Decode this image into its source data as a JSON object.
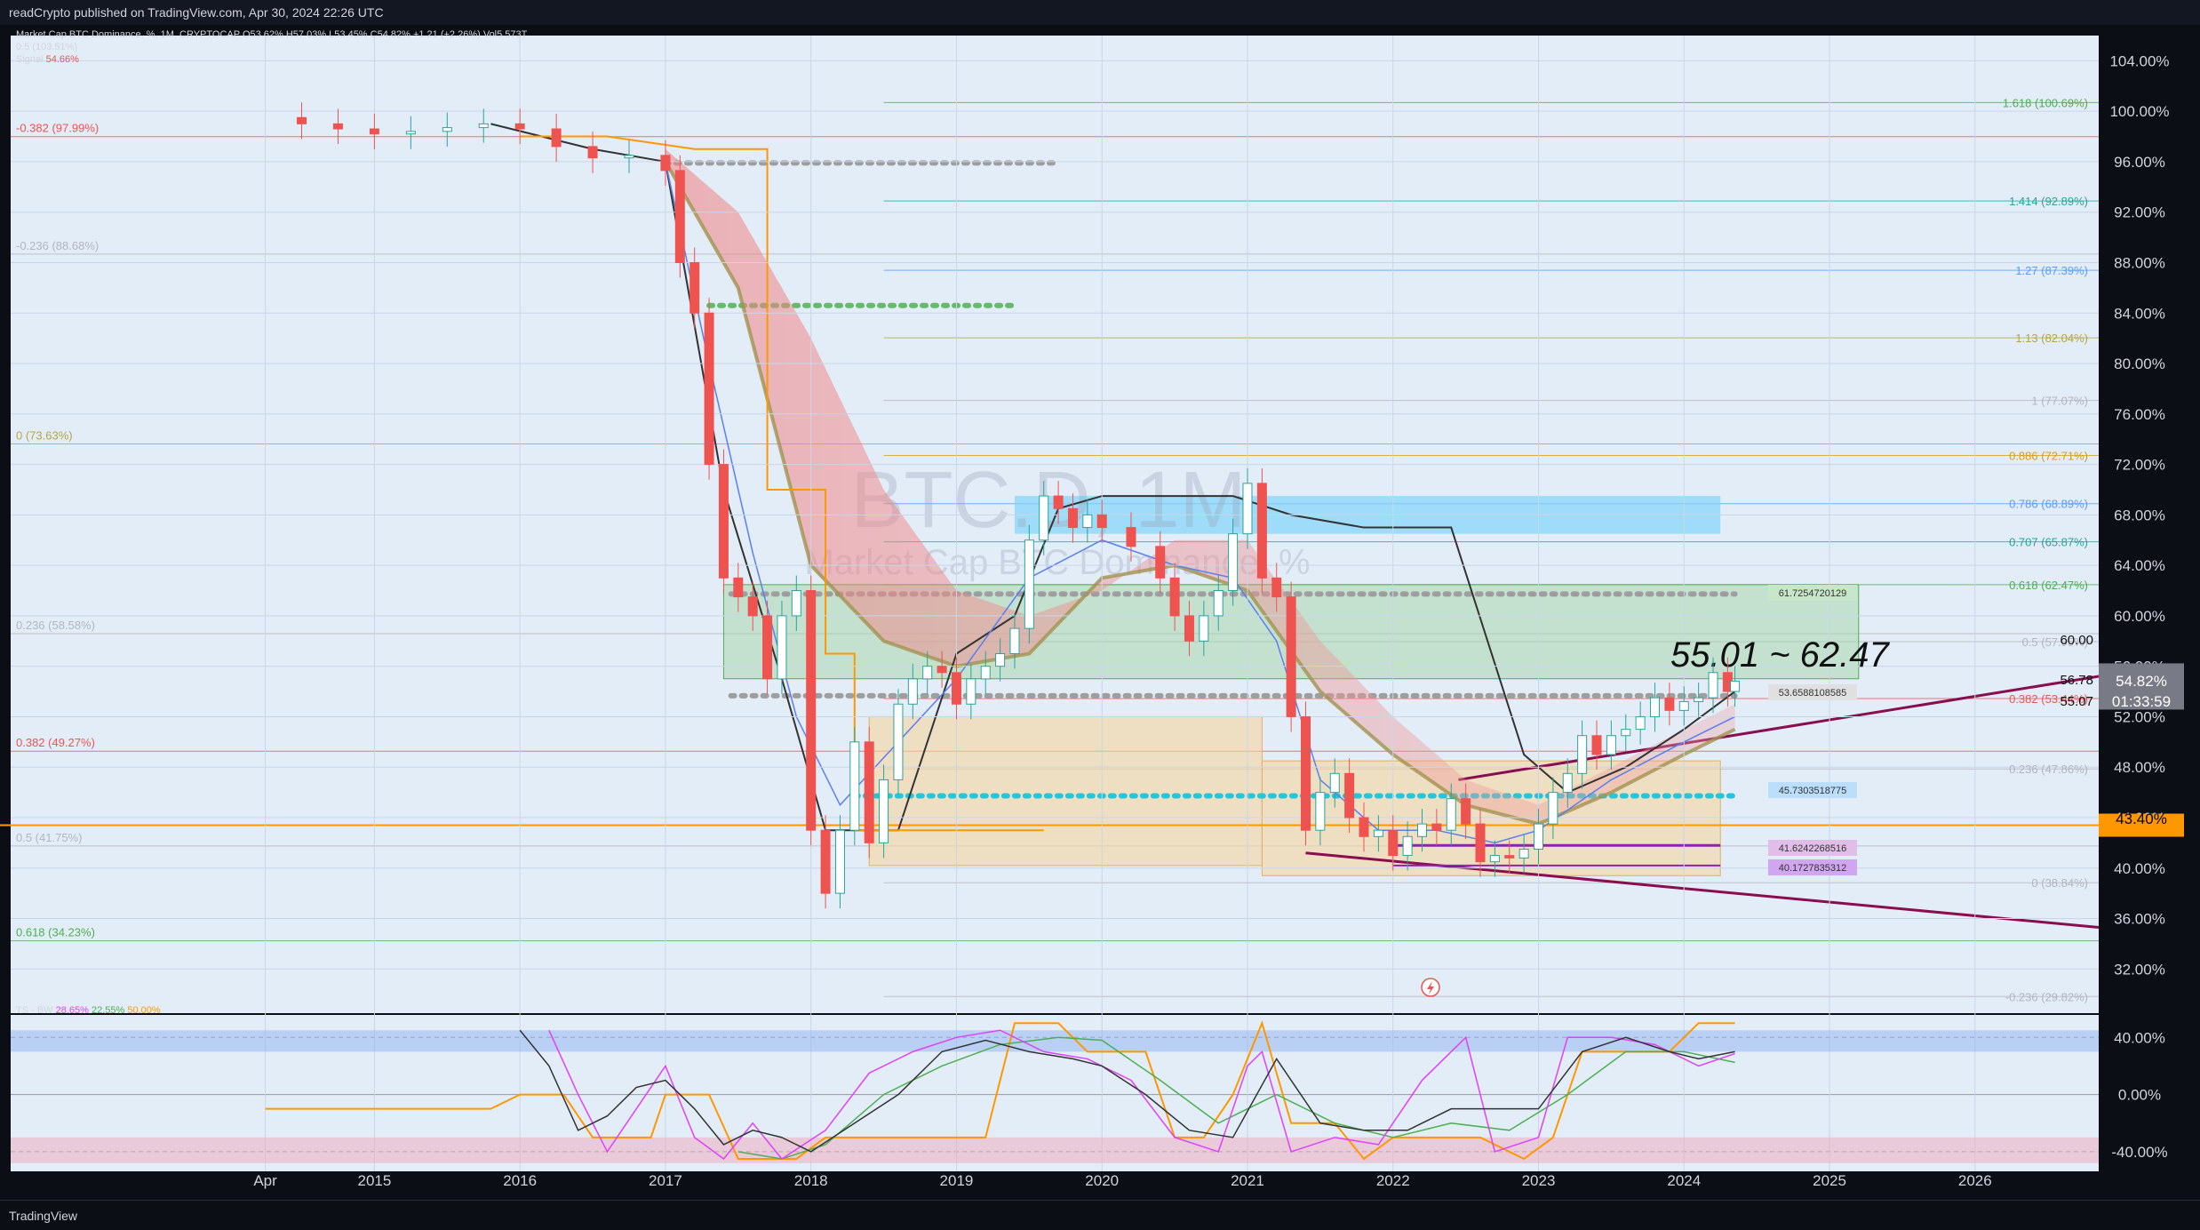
{
  "header": {
    "published": "readCrypto published on TradingView.com, Apr 30, 2024 22:26 UTC"
  },
  "legend": {
    "symbol_line": "Market Cap BTC Dominance, %, 1M, CRYPTOCAP",
    "ohlc": "O53.62% H57.03% L53.45% C54.82% +1.21 (+2.26%) Vol5.573T",
    "indicator_line": "0.5 (103.51%)",
    "signal_label": "Signal",
    "signal_value": "54.66%",
    "oscillator_label": "TS - BW",
    "osc_values": [
      "28.65%",
      "22.55%",
      "50.00%"
    ]
  },
  "watermark": {
    "symbol": "BTC.D, 1M",
    "description": "Market Cap BTC Dominance, %"
  },
  "annotation": {
    "range_text": "55.01 ~ 62.47"
  },
  "right_axis": {
    "price_label": "54.82%",
    "countdown": "01:33:59",
    "level_label": "43.40%",
    "level_color": "#ff9800",
    "price_color": "#787b86"
  },
  "badge_labels": {
    "b1": "61.7254720129",
    "b2": "53.6588108585",
    "b3": "45.7303518775",
    "b4": "41.6242268516",
    "b5": "40.1727835312",
    "b6": "60.00",
    "b7": "56.78",
    "b8": "55.07"
  },
  "left_fib_labels": [
    {
      "text": "-0.382 (97.99%)",
      "value": 97.99,
      "color": "#ef5350"
    },
    {
      "text": "-0.236 (88.68%)",
      "value": 88.68,
      "color": "#b2b5be"
    },
    {
      "text": "0 (73.63%)",
      "value": 73.63,
      "color": "#b5a642"
    },
    {
      "text": "0.236 (58.58%)",
      "value": 58.58,
      "color": "#b2b5be"
    },
    {
      "text": "0.382 (49.27%)",
      "value": 49.27,
      "color": "#ef5350"
    },
    {
      "text": "0.5 (41.75%)",
      "value": 41.75,
      "color": "#b2b5be"
    },
    {
      "text": "0.618 (34.23%)",
      "value": 34.23,
      "color": "#4caf50"
    }
  ],
  "right_fib_labels": [
    {
      "text": "1.618 (100.69%)",
      "value": 100.69,
      "color": "#4caf50"
    },
    {
      "text": "1.414 (92.89%)",
      "value": 92.89,
      "color": "#26a69a"
    },
    {
      "text": "1.27 (87.39%)",
      "value": 87.39,
      "color": "#5b9cf6"
    },
    {
      "text": "1.13 (82.04%)",
      "value": 82.04,
      "color": "#b5a642"
    },
    {
      "text": "1 (77.07%)",
      "value": 77.07,
      "color": "#b2b5be"
    },
    {
      "text": "0.886 (72.71%)",
      "value": 72.71,
      "color": "#d4a017"
    },
    {
      "text": "0.786 (68.89%)",
      "value": 68.89,
      "color": "#5b9cf6"
    },
    {
      "text": "0.707 (65.87%)",
      "value": 65.87,
      "color": "#26a69a"
    },
    {
      "text": "0.618 (62.47%)",
      "value": 62.47,
      "color": "#4caf50"
    },
    {
      "text": "0.5 (57.95%)",
      "value": 57.95,
      "color": "#b2b5be"
    },
    {
      "text": "0.382 (53.44%)",
      "value": 53.44,
      "color": "#ef5350"
    },
    {
      "text": "0.236 (47.86%)",
      "value": 47.86,
      "color": "#b2b5be"
    },
    {
      "text": "0 (38.84%)",
      "value": 38.84,
      "color": "#b2b5be"
    },
    {
      "text": "-0.236 (29.82%)",
      "value": 29.82,
      "color": "#b2b5be"
    }
  ],
  "chart_data": {
    "type": "line",
    "title": "",
    "ylabel": "",
    "ylim": [
      28.5,
      106
    ],
    "price_ticks": [
      "104.00%",
      "100.00%",
      "96.00%",
      "92.00%",
      "88.00%",
      "84.00%",
      "80.00%",
      "76.00%",
      "72.00%",
      "68.00%",
      "64.00%",
      "60.00%",
      "56.00%",
      "52.00%",
      "48.00%",
      "44.00%",
      "40.00%",
      "36.00%",
      "32.00%"
    ],
    "price_tick_values": [
      104,
      100,
      96,
      92,
      88,
      84,
      80,
      76,
      72,
      68,
      64,
      60,
      56,
      52,
      48,
      44,
      40,
      36,
      32
    ],
    "x_tick_labels": [
      "Apr",
      "2015",
      "2016",
      "2017",
      "2018",
      "2019",
      "2020",
      "2021",
      "2022",
      "2023",
      "2024",
      "2025",
      "2026"
    ],
    "x_tick_years": [
      2014.25,
      2015,
      2016,
      2017,
      2018,
      2019,
      2020,
      2021,
      2022,
      2023,
      2024,
      2025,
      2026
    ],
    "xlim": [
      2012.5,
      2026.85
    ],
    "series": [
      {
        "values": [
          [
            2014.25,
            99.5
          ],
          [
            2014.5,
            99.0
          ],
          [
            2014.75,
            98.6
          ],
          [
            2015.0,
            98.2
          ],
          [
            2015.25,
            98.4
          ],
          [
            2015.5,
            98.7
          ],
          [
            2015.75,
            99.0
          ],
          [
            2016.0,
            98.6
          ],
          [
            2016.25,
            97.2
          ],
          [
            2016.5,
            96.3
          ],
          [
            2016.75,
            96.5
          ],
          [
            2017.0,
            95.3
          ],
          [
            2017.1,
            88.0
          ],
          [
            2017.2,
            84.0
          ],
          [
            2017.3,
            72.0
          ],
          [
            2017.4,
            63.0
          ],
          [
            2017.5,
            61.5
          ],
          [
            2017.6,
            60.0
          ],
          [
            2017.7,
            55.0
          ],
          [
            2017.8,
            60.0
          ],
          [
            2017.9,
            62.0
          ],
          [
            2018.0,
            43.0
          ],
          [
            2018.1,
            38.0
          ],
          [
            2018.2,
            43.0
          ],
          [
            2018.3,
            50.0
          ],
          [
            2018.4,
            42.0
          ],
          [
            2018.5,
            47.0
          ],
          [
            2018.6,
            53.0
          ],
          [
            2018.7,
            55.0
          ],
          [
            2018.8,
            56.0
          ],
          [
            2018.9,
            55.5
          ],
          [
            2019.0,
            53.0
          ],
          [
            2019.1,
            55.0
          ],
          [
            2019.2,
            56.0
          ],
          [
            2019.3,
            57.0
          ],
          [
            2019.4,
            59.0
          ],
          [
            2019.5,
            66.0
          ],
          [
            2019.6,
            69.5
          ],
          [
            2019.7,
            68.5
          ],
          [
            2019.8,
            67.0
          ],
          [
            2019.9,
            68.0
          ],
          [
            2020.0,
            67.0
          ],
          [
            2020.2,
            65.5
          ],
          [
            2020.4,
            63.0
          ],
          [
            2020.5,
            60.0
          ],
          [
            2020.6,
            58.0
          ],
          [
            2020.7,
            60.0
          ],
          [
            2020.8,
            62.0
          ],
          [
            2020.9,
            66.5
          ],
          [
            2021.0,
            70.5
          ],
          [
            2021.1,
            63.0
          ],
          [
            2021.2,
            61.5
          ],
          [
            2021.3,
            52.0
          ],
          [
            2021.4,
            43.0
          ],
          [
            2021.5,
            46.0
          ],
          [
            2021.6,
            47.5
          ],
          [
            2021.7,
            44.0
          ],
          [
            2021.8,
            42.5
          ],
          [
            2021.9,
            43.0
          ],
          [
            2022.0,
            41.0
          ],
          [
            2022.1,
            42.5
          ],
          [
            2022.2,
            43.5
          ],
          [
            2022.3,
            43.0
          ],
          [
            2022.4,
            45.5
          ],
          [
            2022.5,
            43.5
          ],
          [
            2022.6,
            40.5
          ],
          [
            2022.7,
            41.0
          ],
          [
            2022.8,
            40.8
          ],
          [
            2022.9,
            41.5
          ],
          [
            2023.0,
            43.5
          ],
          [
            2023.1,
            46.0
          ],
          [
            2023.2,
            47.5
          ],
          [
            2023.3,
            50.5
          ],
          [
            2023.4,
            49.0
          ],
          [
            2023.5,
            50.5
          ],
          [
            2023.6,
            51.0
          ],
          [
            2023.7,
            52.0
          ],
          [
            2023.8,
            53.5
          ],
          [
            2023.9,
            52.5
          ],
          [
            2024.0,
            53.2
          ],
          [
            2024.1,
            53.5
          ],
          [
            2024.2,
            55.5
          ],
          [
            2024.3,
            54.0
          ],
          [
            2024.35,
            54.82
          ]
        ]
      }
    ],
    "oscillator": {
      "ylim": [
        -50,
        52
      ],
      "ticks": [
        "40.00%",
        "0.00%",
        "-40.00%"
      ],
      "tick_values": [
        40,
        0,
        -40
      ],
      "black_line": [
        [
          2016.0,
          45
        ],
        [
          2016.2,
          20
        ],
        [
          2016.4,
          -25
        ],
        [
          2016.6,
          -15
        ],
        [
          2016.8,
          5
        ],
        [
          2017.0,
          10
        ],
        [
          2017.2,
          -10
        ],
        [
          2017.4,
          -35
        ],
        [
          2017.6,
          -25
        ],
        [
          2017.8,
          -30
        ],
        [
          2018.0,
          -40
        ],
        [
          2018.3,
          -20
        ],
        [
          2018.6,
          0
        ],
        [
          2018.9,
          30
        ],
        [
          2019.2,
          38
        ],
        [
          2019.5,
          30
        ],
        [
          2019.8,
          25
        ],
        [
          2020.0,
          20
        ],
        [
          2020.3,
          0
        ],
        [
          2020.6,
          -25
        ],
        [
          2020.9,
          -30
        ],
        [
          2021.2,
          25
        ],
        [
          2021.5,
          -20
        ],
        [
          2021.8,
          -25
        ],
        [
          2022.1,
          -25
        ],
        [
          2022.4,
          -10
        ],
        [
          2022.7,
          -10
        ],
        [
          2023.0,
          -10
        ],
        [
          2023.3,
          30
        ],
        [
          2023.6,
          40
        ],
        [
          2023.9,
          30
        ],
        [
          2024.1,
          25
        ],
        [
          2024.35,
          30
        ]
      ],
      "magenta_line": [
        [
          2016.2,
          45
        ],
        [
          2016.4,
          0
        ],
        [
          2016.6,
          -40
        ],
        [
          2016.8,
          -10
        ],
        [
          2017.0,
          20
        ],
        [
          2017.2,
          -30
        ],
        [
          2017.4,
          -45
        ],
        [
          2017.6,
          -20
        ],
        [
          2017.8,
          -45
        ],
        [
          2018.1,
          -25
        ],
        [
          2018.4,
          15
        ],
        [
          2018.7,
          30
        ],
        [
          2019.0,
          40
        ],
        [
          2019.3,
          45
        ],
        [
          2019.6,
          30
        ],
        [
          2019.9,
          25
        ],
        [
          2020.2,
          10
        ],
        [
          2020.5,
          -30
        ],
        [
          2020.8,
          -40
        ],
        [
          2021.0,
          20
        ],
        [
          2021.1,
          30
        ],
        [
          2021.3,
          -40
        ],
        [
          2021.6,
          -30
        ],
        [
          2021.9,
          -35
        ],
        [
          2022.2,
          10
        ],
        [
          2022.5,
          40
        ],
        [
          2022.7,
          -40
        ],
        [
          2023.0,
          -30
        ],
        [
          2023.2,
          40
        ],
        [
          2023.5,
          40
        ],
        [
          2023.8,
          35
        ],
        [
          2024.1,
          20
        ],
        [
          2024.35,
          28.65
        ]
      ],
      "green_line": [
        [
          2017.5,
          -40
        ],
        [
          2017.8,
          -45
        ],
        [
          2018.1,
          -35
        ],
        [
          2018.5,
          0
        ],
        [
          2018.9,
          20
        ],
        [
          2019.3,
          35
        ],
        [
          2019.7,
          40
        ],
        [
          2020.0,
          38
        ],
        [
          2020.4,
          10
        ],
        [
          2020.8,
          -20
        ],
        [
          2021.2,
          0
        ],
        [
          2021.6,
          -20
        ],
        [
          2022.0,
          -30
        ],
        [
          2022.4,
          -20
        ],
        [
          2022.8,
          -25
        ],
        [
          2023.2,
          0
        ],
        [
          2023.6,
          30
        ],
        [
          2024.0,
          30
        ],
        [
          2024.35,
          22.55
        ]
      ],
      "orange_line": [
        [
          2014.25,
          -10
        ],
        [
          2015.8,
          -10
        ],
        [
          2016.0,
          0
        ],
        [
          2016.3,
          0
        ],
        [
          2016.5,
          -30
        ],
        [
          2016.9,
          -30
        ],
        [
          2017.0,
          0
        ],
        [
          2017.3,
          0
        ],
        [
          2017.5,
          -45
        ],
        [
          2017.9,
          -45
        ],
        [
          2018.1,
          -30
        ],
        [
          2019.2,
          -30
        ],
        [
          2019.4,
          50
        ],
        [
          2019.7,
          50
        ],
        [
          2019.9,
          30
        ],
        [
          2020.3,
          30
        ],
        [
          2020.5,
          -30
        ],
        [
          2020.7,
          -30
        ],
        [
          2020.9,
          0
        ],
        [
          2021.1,
          50
        ],
        [
          2021.3,
          -20
        ],
        [
          2021.6,
          -20
        ],
        [
          2021.8,
          -45
        ],
        [
          2022.0,
          -30
        ],
        [
          2022.3,
          -30
        ],
        [
          2022.6,
          -30
        ],
        [
          2022.9,
          -45
        ],
        [
          2023.1,
          -30
        ],
        [
          2023.3,
          30
        ],
        [
          2023.6,
          30
        ],
        [
          2023.9,
          30
        ],
        [
          2024.1,
          50
        ],
        [
          2024.35,
          50
        ]
      ]
    }
  }
}
